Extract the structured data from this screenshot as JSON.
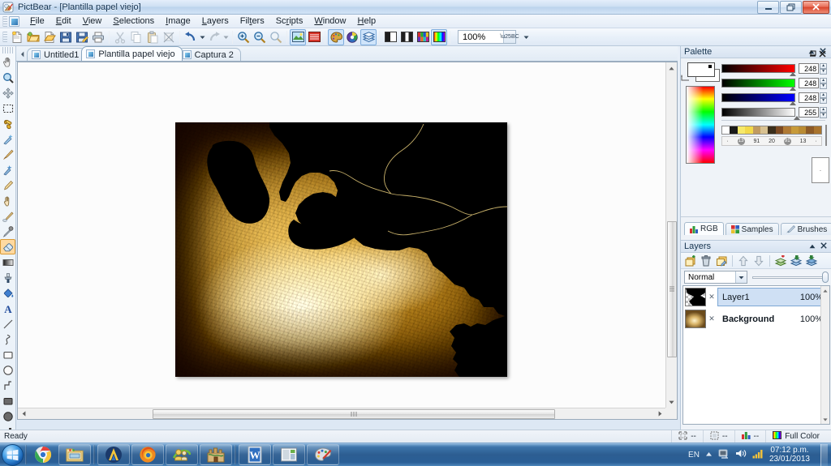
{
  "window": {
    "title": "PictBear - [Plantilla papel viejo]",
    "app_icon": "pictbear-icon",
    "controls": {
      "minimize": "–",
      "restore": "❐",
      "close": "✕"
    },
    "mdi_controls": {
      "minimize": "–",
      "restore": "❐",
      "close": "✕"
    }
  },
  "menubar": {
    "items": [
      {
        "label": "File"
      },
      {
        "label": "Edit"
      },
      {
        "label": "View"
      },
      {
        "label": "Selections"
      },
      {
        "label": "Image"
      },
      {
        "label": "Layers"
      },
      {
        "label": "Filters"
      },
      {
        "label": "Scripts"
      },
      {
        "label": "Window"
      },
      {
        "label": "Help"
      }
    ]
  },
  "toolbar": {
    "buttons": [
      {
        "name": "new-file-icon",
        "tip": "New"
      },
      {
        "name": "open-file-icon",
        "tip": "Open"
      },
      {
        "name": "open-recent-icon",
        "tip": "Open Recent"
      },
      {
        "name": "save-icon",
        "tip": "Save"
      },
      {
        "name": "save-as-icon",
        "tip": "Save As"
      },
      {
        "name": "print-icon",
        "tip": "Print"
      },
      {
        "name": "cut-icon",
        "tip": "Cut"
      },
      {
        "name": "copy-icon",
        "tip": "Copy"
      },
      {
        "name": "paste-icon",
        "tip": "Paste"
      },
      {
        "name": "delete-icon",
        "tip": "Delete"
      },
      {
        "name": "undo-icon",
        "tip": "Undo"
      },
      {
        "name": "redo-icon",
        "tip": "Redo"
      },
      {
        "name": "zoom-in-icon",
        "tip": "Zoom In"
      },
      {
        "name": "zoom-out-icon",
        "tip": "Zoom Out"
      },
      {
        "name": "zoom-fit-icon",
        "tip": "Zoom Fit"
      },
      {
        "name": "image-panel-icon",
        "tip": "Image"
      },
      {
        "name": "navigator-icon",
        "tip": "Navigator"
      },
      {
        "name": "palette-panel-icon",
        "tip": "Palette"
      },
      {
        "name": "color-wheel-icon",
        "tip": "Color"
      },
      {
        "name": "layers-panel-icon",
        "tip": "Layers"
      },
      {
        "name": "grayscale-icon",
        "tip": "Grayscale"
      },
      {
        "name": "duotone-icon",
        "tip": "Duotone"
      },
      {
        "name": "indexed-color-icon",
        "tip": "Indexed Color"
      },
      {
        "name": "full-color-icon",
        "tip": "Full Color"
      }
    ],
    "zoom_value": "100%"
  },
  "toolbox": {
    "tools": [
      {
        "name": "hand-tool",
        "label": "Hand",
        "glyph": "✋"
      },
      {
        "name": "zoom-tool",
        "label": "Zoom",
        "glyph": "🔍"
      },
      {
        "name": "move-tool",
        "label": "Move",
        "glyph": "✥"
      },
      {
        "name": "rect-select-tool",
        "label": "Rectangular Select",
        "glyph": "⬚"
      },
      {
        "name": "fill-tool",
        "label": "Fill",
        "glyph": "🪣"
      },
      {
        "name": "magic-wand-tool",
        "label": "Magic Wand",
        "glyph": "✦"
      },
      {
        "name": "brush-tool",
        "label": "Brush",
        "glyph": "✐"
      },
      {
        "name": "airbrush-tool",
        "label": "Airbrush",
        "glyph": "✳"
      },
      {
        "name": "pen-tool",
        "label": "Pen",
        "glyph": "✎"
      },
      {
        "name": "smudge-tool",
        "label": "Smudge",
        "glyph": "👆"
      },
      {
        "name": "blur-tool",
        "label": "Blur",
        "glyph": "◖"
      },
      {
        "name": "eyedropper-tool",
        "label": "Eyedropper",
        "glyph": "💉"
      },
      {
        "name": "eraser-tool",
        "label": "Eraser",
        "glyph": "▭",
        "selected": true
      },
      {
        "name": "gradient-tool",
        "label": "Gradient",
        "glyph": "▨"
      },
      {
        "name": "clone-stamp-tool",
        "label": "Clone Stamp",
        "glyph": "☂"
      },
      {
        "name": "paint-bucket-tool",
        "label": "Paint Bucket",
        "glyph": "🪣"
      },
      {
        "name": "text-tool",
        "label": "Text",
        "glyph": "A"
      },
      {
        "name": "line-tool",
        "label": "Line",
        "glyph": "╱"
      },
      {
        "name": "curve-tool",
        "label": "Curve",
        "glyph": "∿"
      },
      {
        "name": "rectangle-tool",
        "label": "Rectangle",
        "glyph": "□"
      },
      {
        "name": "ellipse-tool",
        "label": "Ellipse",
        "glyph": "○"
      },
      {
        "name": "polyline-tool",
        "label": "Polyline",
        "glyph": "⤴"
      },
      {
        "name": "filled-rectangle-tool",
        "label": "Filled Rectangle",
        "glyph": "■"
      },
      {
        "name": "filled-ellipse-tool",
        "label": "Filled Ellipse",
        "glyph": "●"
      },
      {
        "name": "filled-polygon-tool",
        "label": "Filled Polygon",
        "glyph": "◢"
      }
    ]
  },
  "document_tabs": {
    "nav_prev": "◄",
    "items": [
      {
        "label": "Untitled1",
        "active": false
      },
      {
        "label": "Plantilla papel viejo",
        "active": true
      },
      {
        "label": "Captura 2",
        "active": false
      }
    ],
    "minimize": "–",
    "close": "✕"
  },
  "canvas": {
    "scroll_h_thumb": "⦀",
    "scroll_v_thumb": "≡",
    "arrow_left": "◄",
    "arrow_right": "►",
    "arrow_up": "▲",
    "arrow_down": "▼",
    "image_alt": "Aged paper texture with black masked cut-out region"
  },
  "palette": {
    "title": "Palette",
    "minimize": "▲",
    "close": "✕",
    "channels": [
      {
        "name": "red",
        "value": "248",
        "start": "#000000",
        "end": "#ff0000"
      },
      {
        "name": "green",
        "value": "248",
        "start": "#000000",
        "end": "#00ff00"
      },
      {
        "name": "blue",
        "value": "248",
        "start": "#000000",
        "end": "#0000ff"
      },
      {
        "name": "alpha",
        "value": "255",
        "start": "#000000",
        "end": "#ffffff"
      }
    ],
    "recent_colors": [
      "#ffffff",
      "#1a1a1a",
      "#f6e96a",
      "#f2d94a",
      "#c09a60",
      "#d8c191",
      "#3a2e1c",
      "#7c4a23",
      "#b07a35",
      "#c79a3a",
      "#b98b34",
      "#8c5a26",
      "#a9742d"
    ],
    "history_labels": [
      "·",
      "13",
      "91",
      "20",
      "91",
      "13",
      "·"
    ],
    "tabs": [
      {
        "label": "RGB",
        "icon": "rgb-icon",
        "active": true
      },
      {
        "label": "Samples",
        "icon": "samples-icon",
        "active": false
      },
      {
        "label": "Brushes",
        "icon": "brushes-icon",
        "active": false
      }
    ]
  },
  "layers": {
    "title": "Layers",
    "minimize": "▲",
    "close": "✕",
    "toolbar_buttons": [
      {
        "name": "new-layer-icon"
      },
      {
        "name": "delete-layer-icon"
      },
      {
        "name": "duplicate-layer-icon"
      },
      {
        "name": "move-layer-up-icon"
      },
      {
        "name": "move-layer-down-icon"
      },
      {
        "name": "add-mask-icon"
      },
      {
        "name": "merge-down-icon"
      },
      {
        "name": "flatten-icon"
      }
    ],
    "blend_mode": "Normal",
    "opacity_label": "100",
    "rows": [
      {
        "name": "Layer1",
        "opacity": "100%",
        "visible": "✕",
        "selected": true,
        "thumb": "transparent-with-black-shape"
      },
      {
        "name": "Background",
        "opacity": "100%",
        "visible": "✕",
        "selected": false,
        "thumb": "aged-paper"
      }
    ]
  },
  "statusbar": {
    "message": "Ready",
    "size_value": "--",
    "selection_value": "--",
    "color_value": "--",
    "mode": "Full Color"
  },
  "taskbar": {
    "start_label": "Start",
    "items": [
      {
        "name": "chrome-taskbar-icon",
        "label": "Google Chrome"
      },
      {
        "name": "explorer-taskbar-icon",
        "label": "Windows Explorer"
      },
      {
        "name": "avira-taskbar-icon",
        "label": "Avira"
      },
      {
        "name": "firefox-taskbar-icon",
        "label": "Mozilla Firefox"
      },
      {
        "name": "messenger-taskbar-icon",
        "label": "Messenger"
      },
      {
        "name": "ares-taskbar-icon",
        "label": "Ares"
      },
      {
        "name": "word-taskbar-icon",
        "label": "Microsoft Word"
      },
      {
        "name": "powerpoint-taskbar-icon",
        "label": "Microsoft PowerPoint"
      },
      {
        "name": "pictbear-taskbar-icon",
        "label": "PictBear"
      }
    ],
    "tray": {
      "language": "EN",
      "show_hidden": "▲",
      "icons": [
        "network-tray-icon",
        "volume-tray-icon",
        "signal-tray-icon"
      ],
      "time": "07:12 p.m.",
      "date": "23/01/2013"
    }
  }
}
